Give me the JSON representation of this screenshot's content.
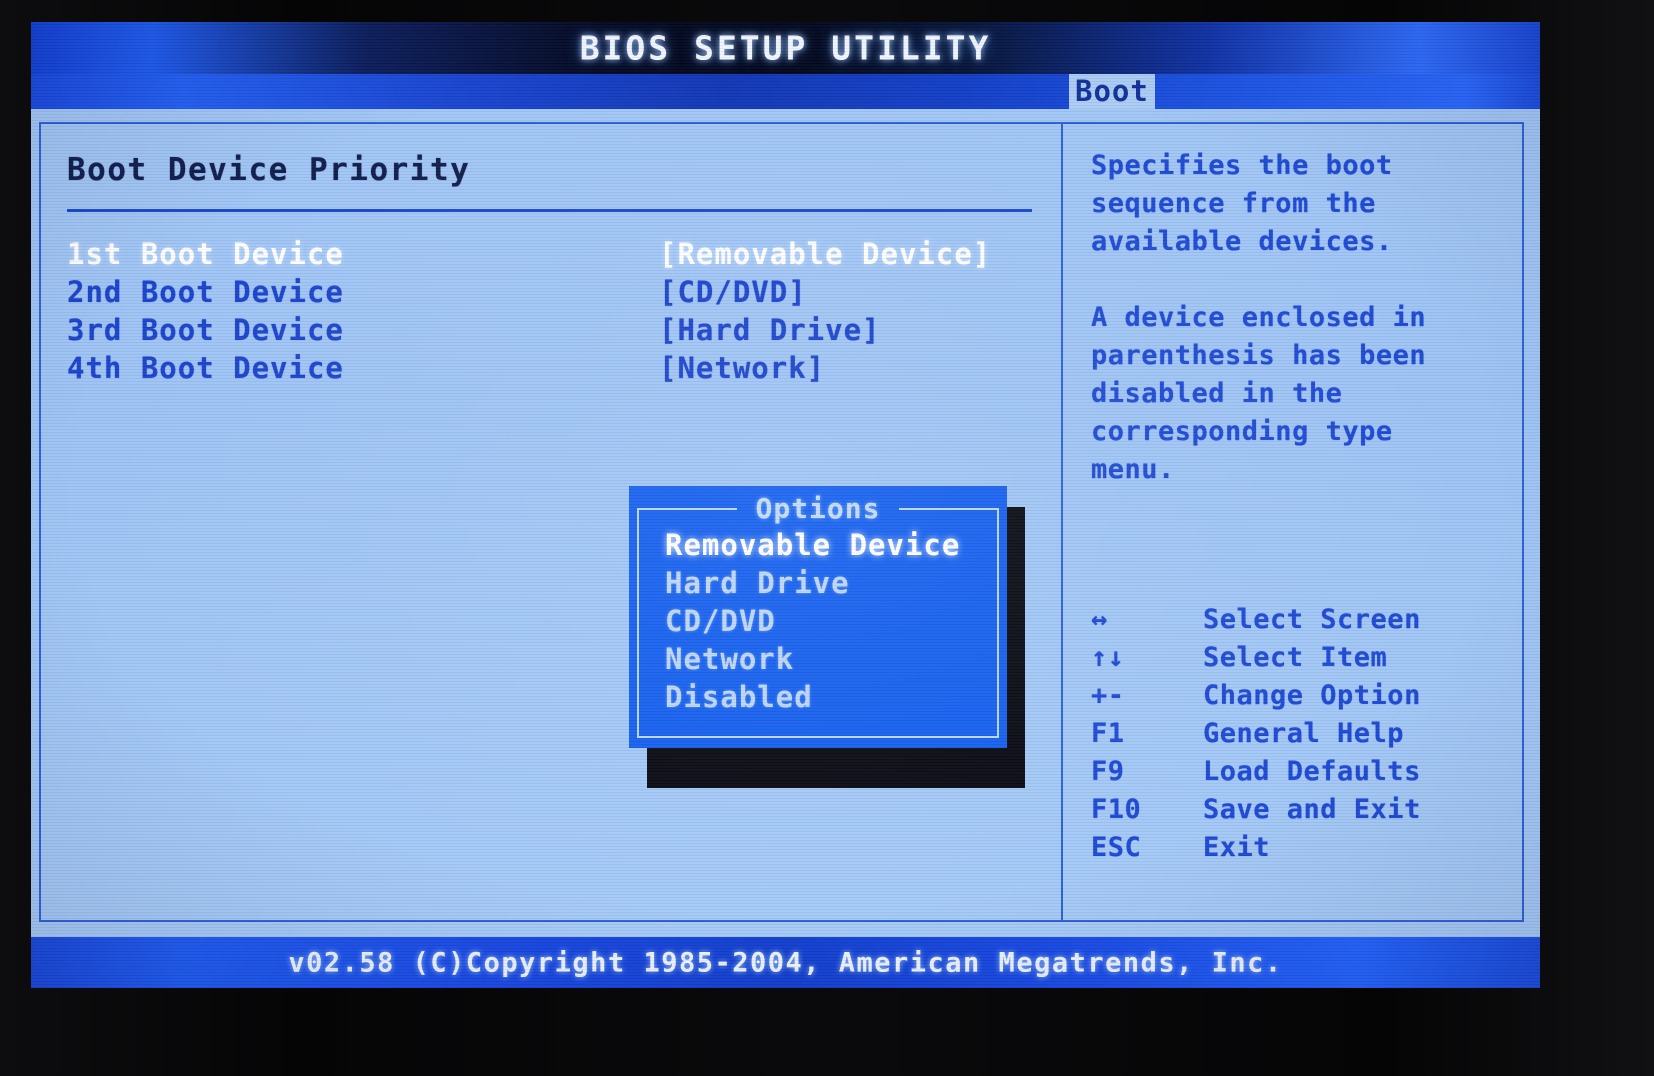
{
  "header": {
    "title": "BIOS SETUP UTILITY",
    "active_tab": "Boot"
  },
  "main": {
    "section_title": "Boot Device Priority",
    "rows": [
      {
        "label": "1st Boot Device",
        "value": "[Removable Device]",
        "selected": true
      },
      {
        "label": "2nd Boot Device",
        "value": "[CD/DVD]",
        "selected": false
      },
      {
        "label": "3rd Boot Device",
        "value": "[Hard Drive]",
        "selected": false
      },
      {
        "label": "4th Boot Device",
        "value": "[Network]",
        "selected": false
      }
    ]
  },
  "options_dialog": {
    "title": "Options",
    "items": [
      {
        "label": "Removable Device",
        "selected": true
      },
      {
        "label": "Hard Drive",
        "selected": false
      },
      {
        "label": "CD/DVD",
        "selected": false
      },
      {
        "label": "Network",
        "selected": false
      },
      {
        "label": "Disabled",
        "selected": false
      }
    ]
  },
  "help": {
    "paragraph1": [
      "Specifies the boot",
      "sequence from the",
      "available devices."
    ],
    "paragraph2": [
      "A device enclosed in",
      "parenthesis has been",
      "disabled in the",
      "corresponding type",
      "menu."
    ],
    "legend": [
      {
        "key": "↔",
        "desc": "Select Screen",
        "icon": "left-right-arrow-icon"
      },
      {
        "key": "↑↓",
        "desc": "Select Item",
        "icon": "up-down-arrow-icon"
      },
      {
        "key": "+-",
        "desc": "Change Option",
        "icon": "plus-minus-icon"
      },
      {
        "key": "F1",
        "desc": "General Help",
        "icon": "f1-key-icon"
      },
      {
        "key": "F9",
        "desc": "Load Defaults",
        "icon": "f9-key-icon"
      },
      {
        "key": "F10",
        "desc": "Save and Exit",
        "icon": "f10-key-icon"
      },
      {
        "key": "ESC",
        "desc": "Exit",
        "icon": "esc-key-icon"
      }
    ]
  },
  "footer": {
    "text": "v02.58 (C)Copyright 1985-2004, American Megatrends, Inc."
  },
  "colors": {
    "screen_bg": "#9dc3f5",
    "title_bar_blue": "#1a49da",
    "tab_active_bg": "#accdf6",
    "tab_active_text": "#12329c",
    "text_blue": "#1c44cd",
    "text_selected": "#ffffff",
    "heading_dark": "#111f4e",
    "dialog_bg": "#1560f0",
    "dialog_border": "#b9d5f8",
    "frame_border": "#2f62d8",
    "bezel_black": "#080808"
  }
}
